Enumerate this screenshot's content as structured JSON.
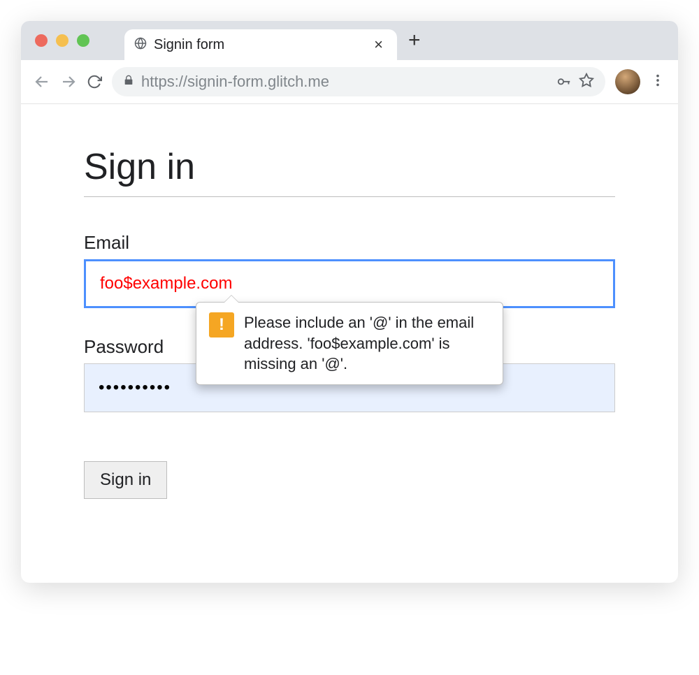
{
  "browser": {
    "tab_title": "Signin form",
    "url": "https://signin-form.glitch.me"
  },
  "page": {
    "title": "Sign in",
    "email_label": "Email",
    "email_value": "foo$example.com",
    "password_label": "Password",
    "password_value": "••••••••••",
    "submit_label": "Sign in"
  },
  "tooltip": {
    "message": "Please include an '@' in the email address. 'foo$example.com' is missing an '@'."
  }
}
